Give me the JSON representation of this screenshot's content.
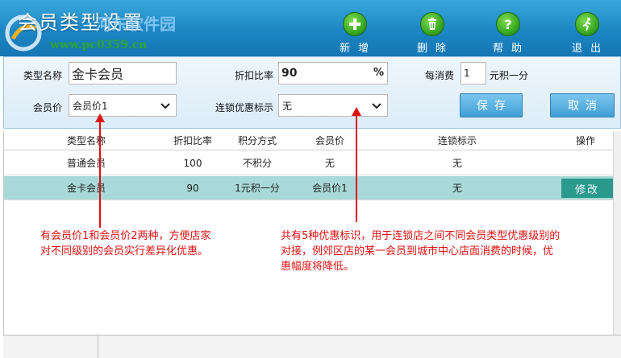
{
  "window": {
    "title": "会员类型设置"
  },
  "watermark": {
    "site": "河东软件园",
    "url": "www.pc0359.cn"
  },
  "toolbar": {
    "add_label": "新增",
    "delete_label": "删除",
    "help_label": "帮助",
    "exit_label": "退出"
  },
  "form": {
    "type_name_label": "类型名称",
    "type_name_value": "金卡会员",
    "discount_label": "折扣比率",
    "discount_value": "90",
    "discount_unit": "%",
    "per_spend_label": "每消费",
    "per_spend_value": "1",
    "per_spend_unit": "元积一分",
    "member_price_label": "会员价",
    "member_price_value": "会员价1",
    "chain_label": "连锁优惠标示",
    "chain_value": "无",
    "save_label": "保存",
    "cancel_label": "取消"
  },
  "table": {
    "columns": [
      "类型名称",
      "折扣比率",
      "积分方式",
      "会员价",
      "连锁标示",
      "操作"
    ],
    "rows": [
      {
        "name": "普通会员",
        "discount": "100",
        "points": "不积分",
        "price": "无",
        "chain": "无",
        "action": ""
      },
      {
        "name": "金卡会员",
        "discount": "90",
        "points": "1元积一分",
        "price": "会员价1",
        "chain": "无",
        "action": "修改"
      }
    ]
  },
  "annotations": {
    "left_line1": "有会员价1和会员价2两种，方便店家",
    "left_line2": "对不同级别的会员实行差异化优惠。",
    "right_line1": "共有5种优惠标识，用于连锁店之间不同会员类型优惠级别的",
    "right_line2": "对接，例郊区店的某一会员到城市中心店面消费的时候，优",
    "right_line3": "惠幅度将降低。"
  },
  "colors": {
    "header": "#1c86c4",
    "selected_row": "#a8d8d8",
    "edit_button": "#2a9a8e",
    "annotation": "#e01010"
  }
}
